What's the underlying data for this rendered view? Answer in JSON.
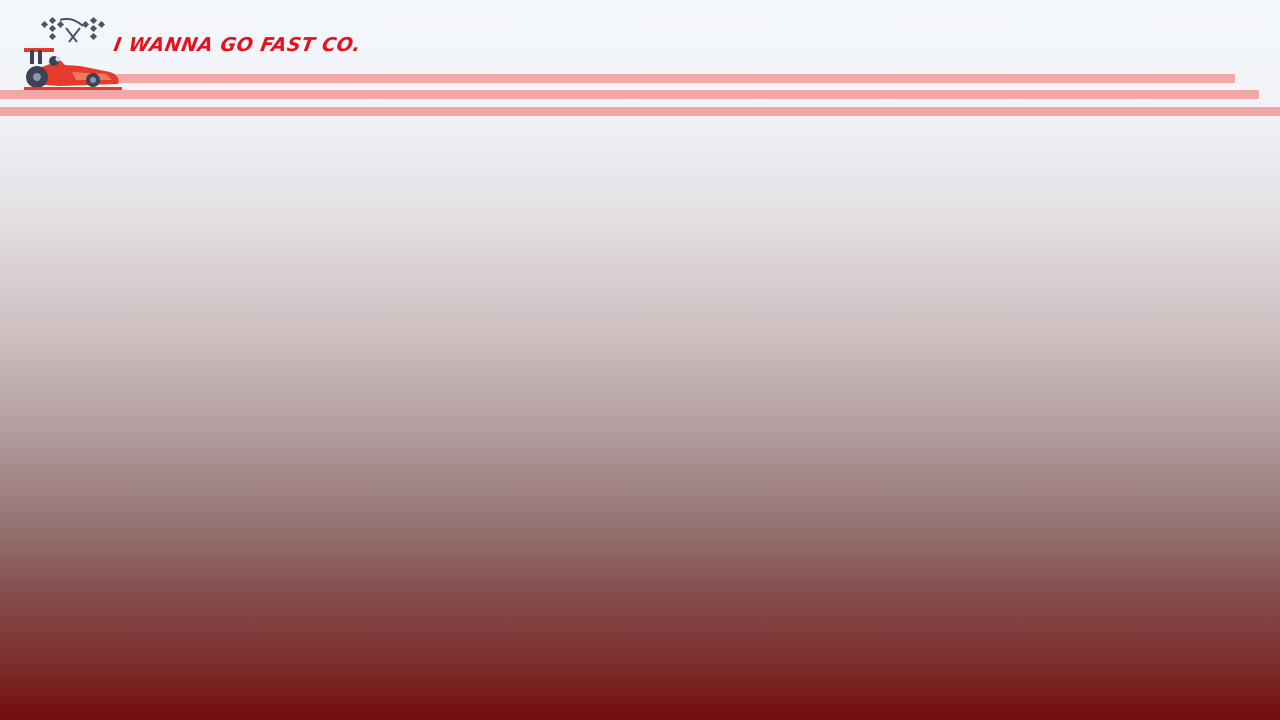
{
  "brand": {
    "name": "I WANNA GO FAST CO.",
    "logo_icon": "race-car-with-checkered-flags-icon",
    "accent_color": "#e3121c"
  },
  "header": {
    "stripe_color": "#f0a7a6"
  },
  "background": {
    "gradient_top": "#f4f7fb",
    "gradient_bottom": "#750c0c"
  }
}
